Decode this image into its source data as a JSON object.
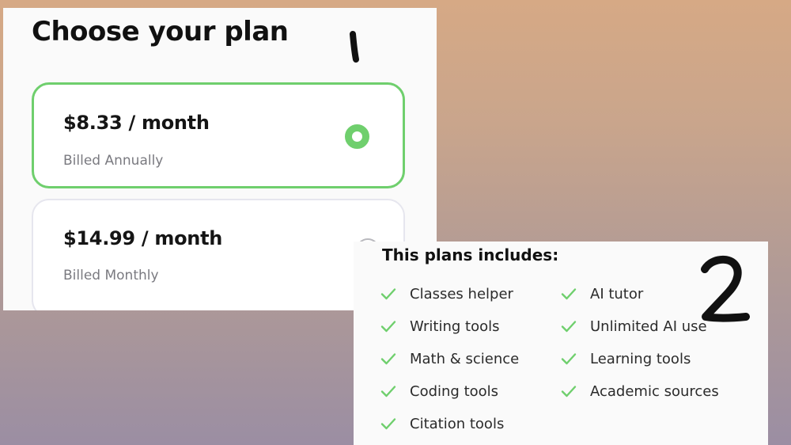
{
  "plan_panel": {
    "title": "Choose your plan",
    "plans": [
      {
        "price": "$8.33 / month",
        "billing": "Billed Annually",
        "selected": true
      },
      {
        "price": "$14.99 / month",
        "billing": "Billed Monthly",
        "selected": false
      }
    ]
  },
  "features_panel": {
    "title": "This plans includes:",
    "left_column": [
      "Classes helper",
      "Writing tools",
      "Math & science",
      "Coding tools",
      "Citation tools"
    ],
    "right_column": [
      "AI tutor",
      "Unlimited AI use",
      "Learning tools",
      "Academic sources"
    ]
  },
  "annotations": {
    "mark_one": "1",
    "mark_two": "2"
  },
  "colors": {
    "accent_green": "#6fcf6d",
    "check_green": "#6fcf6d",
    "text_dark": "#111111",
    "text_muted": "#7a7a80",
    "card_border": "#e6e6ee",
    "panel_bg": "#fafafa",
    "bg_top": "#d6a985",
    "bg_bottom": "#9b8ea3"
  },
  "icons": {
    "selected_radio": "radio-selected-icon",
    "unselected_radio": "radio-unselected-icon",
    "feature_check": "check-icon"
  }
}
